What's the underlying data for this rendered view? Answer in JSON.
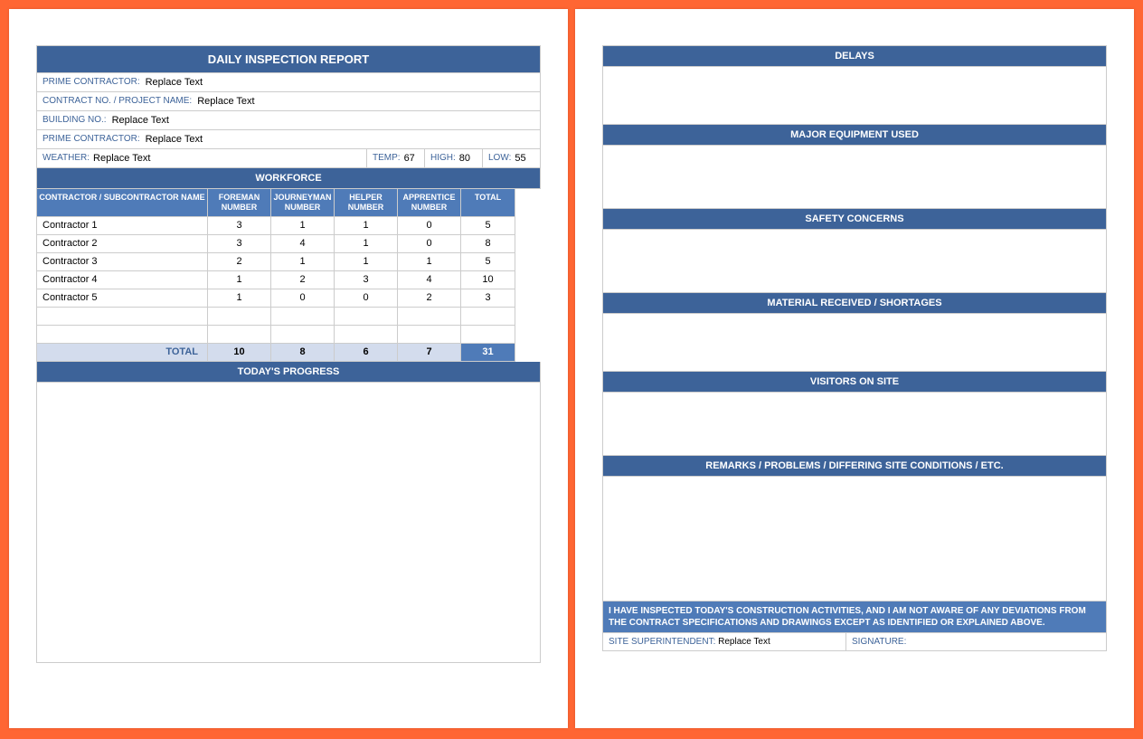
{
  "page1": {
    "title": "DAILY INSPECTION REPORT",
    "fields": [
      {
        "label": "PRIME CONTRACTOR:",
        "value": "Replace Text"
      },
      {
        "label": "CONTRACT NO. / PROJECT NAME:",
        "value": "Replace Text"
      },
      {
        "label": "BUILDING NO.:",
        "value": "Replace Text"
      },
      {
        "label": "PRIME CONTRACTOR:",
        "value": "Replace Text"
      }
    ],
    "weather": {
      "label": "WEATHER:",
      "value": "Replace Text",
      "temp_label": "TEMP:",
      "temp": "67",
      "high_label": "HIGH:",
      "high": "80",
      "low_label": "LOW:",
      "low": "55"
    },
    "workforce": {
      "header": "WORKFORCE",
      "cols": [
        "CONTRACTOR / SUBCONTRACTOR NAME",
        "FOREMAN NUMBER",
        "JOURNEYMAN NUMBER",
        "HELPER NUMBER",
        "APPRENTICE NUMBER",
        "TOTAL"
      ],
      "rows": [
        {
          "name": "Contractor 1",
          "foreman": "3",
          "journeyman": "1",
          "helper": "1",
          "apprentice": "0",
          "total": "5"
        },
        {
          "name": "Contractor 2",
          "foreman": "3",
          "journeyman": "4",
          "helper": "1",
          "apprentice": "0",
          "total": "8"
        },
        {
          "name": "Contractor 3",
          "foreman": "2",
          "journeyman": "1",
          "helper": "1",
          "apprentice": "1",
          "total": "5"
        },
        {
          "name": "Contractor 4",
          "foreman": "1",
          "journeyman": "2",
          "helper": "3",
          "apprentice": "4",
          "total": "10"
        },
        {
          "name": "Contractor 5",
          "foreman": "1",
          "journeyman": "0",
          "helper": "0",
          "apprentice": "2",
          "total": "3"
        }
      ],
      "total_label": "TOTAL",
      "totals": {
        "foreman": "10",
        "journeyman": "8",
        "helper": "6",
        "apprentice": "7",
        "total": "31"
      }
    },
    "progress_label": "TODAY'S PROGRESS"
  },
  "page2": {
    "sections": [
      "DELAYS",
      "MAJOR EQUIPMENT USED",
      "SAFETY CONCERNS",
      "MATERIAL RECEIVED / SHORTAGES",
      "VISITORS ON SITE",
      "REMARKS / PROBLEMS / DIFFERING SITE CONDITIONS / ETC."
    ],
    "cert": "I HAVE INSPECTED TODAY'S CONSTRUCTION ACTIVITIES, AND I AM NOT AWARE OF ANY DEVIATIONS FROM THE CONTRACT SPECIFICATIONS AND DRAWINGS EXCEPT AS IDENTIFIED OR EXPLAINED ABOVE.",
    "superintendent_label": "SITE SUPERINTENDENT:",
    "superintendent_value": "Replace Text",
    "signature_label": "SIGNATURE:"
  }
}
